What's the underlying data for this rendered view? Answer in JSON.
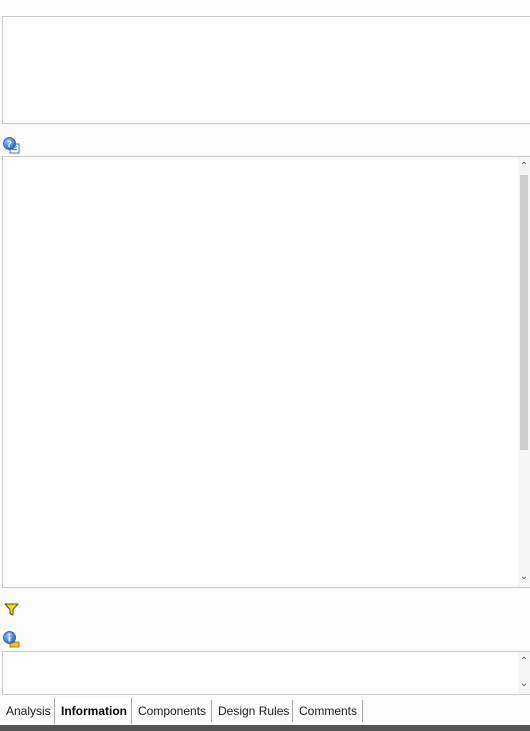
{
  "icons": {
    "help": "help-icon",
    "filter": "filter-icon",
    "info": "info-icon",
    "scroll_up": "chevron-up-icon",
    "scroll_down": "chevron-down-icon"
  },
  "tabs": [
    {
      "label": "Analysis",
      "active": false
    },
    {
      "label": "Information",
      "active": true
    },
    {
      "label": "Components",
      "active": false
    },
    {
      "label": "Design Rules",
      "active": false
    },
    {
      "label": "Comments",
      "active": false
    }
  ],
  "colors": {
    "accent_blue": "#3a7bd5",
    "filter_yellow": "#e8d21f",
    "statusbar": "#545454"
  }
}
